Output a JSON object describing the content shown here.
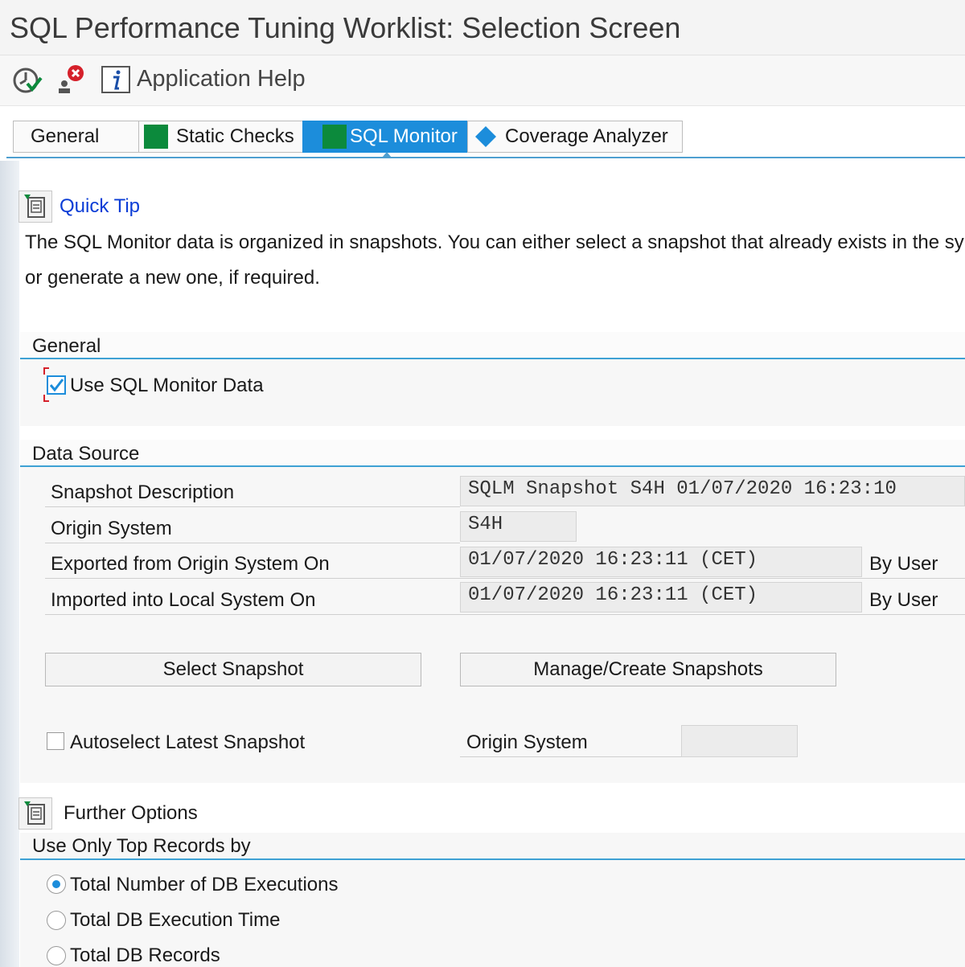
{
  "window": {
    "title": "SQL Performance Tuning Worklist: Selection Screen"
  },
  "toolbar": {
    "execute_icon": "execute-clock-icon",
    "delete_icon": "user-remove-icon",
    "help_icon": "info-icon",
    "help_label": "Application Help"
  },
  "tabs": [
    {
      "label": "General",
      "active": false
    },
    {
      "label": "Static Checks",
      "active": false,
      "marker": "green-square"
    },
    {
      "label": "SQL Monitor",
      "active": true,
      "marker": "green-square"
    },
    {
      "label": "Coverage Analyzer",
      "active": false,
      "marker": "blue-diamond"
    }
  ],
  "quick_tip": {
    "label": "Quick Tip",
    "line1": "The SQL Monitor data is organized in snapshots. You can either select a snapshot that already exists in the sy",
    "line2": "or generate a new one, if required."
  },
  "general_section": {
    "title": "General",
    "use_sql_monitor_label": "Use SQL Monitor Data",
    "use_sql_monitor_checked": true
  },
  "data_source": {
    "title": "Data Source",
    "snapshot_description_label": "Snapshot Description",
    "snapshot_description_value": "SQLM Snapshot S4H 01/07/2020 16:23:10",
    "origin_system_label": "Origin System",
    "origin_system_value": "S4H",
    "exported_label": "Exported from Origin System On",
    "exported_value": "01/07/2020 16:23:11 (CET)",
    "exported_by": "By User",
    "imported_label": "Imported into Local System On",
    "imported_value": "01/07/2020 16:23:11 (CET)",
    "imported_by": "By User",
    "select_snapshot_button": "Select Snapshot",
    "manage_snapshots_button": "Manage/Create Snapshots",
    "autoselect_label": "Autoselect Latest Snapshot",
    "autoselect_checked": false,
    "origin_system_filter_label": "Origin System",
    "origin_system_filter_value": ""
  },
  "further_options": {
    "toggle_label": "Further Options",
    "top_records_title": "Use Only Top Records by",
    "radio_options": [
      {
        "label": "Total Number of DB Executions",
        "selected": true
      },
      {
        "label": "Total DB Execution Time",
        "selected": false
      },
      {
        "label": "Total DB Records",
        "selected": false
      }
    ]
  },
  "colors": {
    "accent": "#1c8ddb",
    "green": "#0c8a3c",
    "link": "#0a3cd6",
    "section_line": "#3ea1d4"
  }
}
